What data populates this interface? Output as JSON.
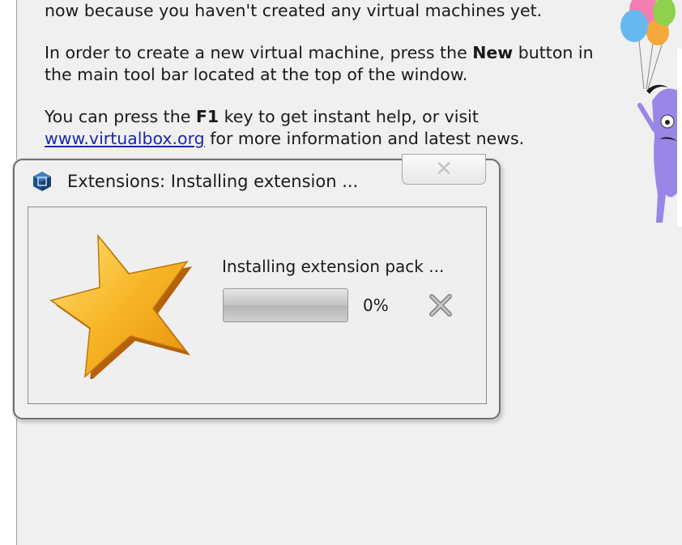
{
  "welcome": {
    "line_fragment": "now because you haven't created any virtual machines yet.",
    "para2_a": "In order to create a new virtual machine, press the ",
    "para2_b": "New",
    "para2_c": " button in the main tool bar located at the top of the window.",
    "para3_a": "You can press the ",
    "para3_b": "F1",
    "para3_c": " key to get instant help, or visit ",
    "link": "www.virtualbox.org",
    "para3_d": " for more information and latest news."
  },
  "dialog": {
    "title": "Extensions: Installing extension ...",
    "close_glyph": "✕",
    "status": "Installing extension pack ...",
    "progress_percent": 0,
    "progress_label": "0%"
  },
  "icons": {
    "app": "virtualbox-cube-icon",
    "star": "star-icon",
    "cancel": "cancel-x-icon",
    "mascot": "mascot-with-balloons"
  },
  "colors": {
    "background": "#f0f0f0",
    "link": "#1a2aa8",
    "star": "#f5b21c"
  }
}
